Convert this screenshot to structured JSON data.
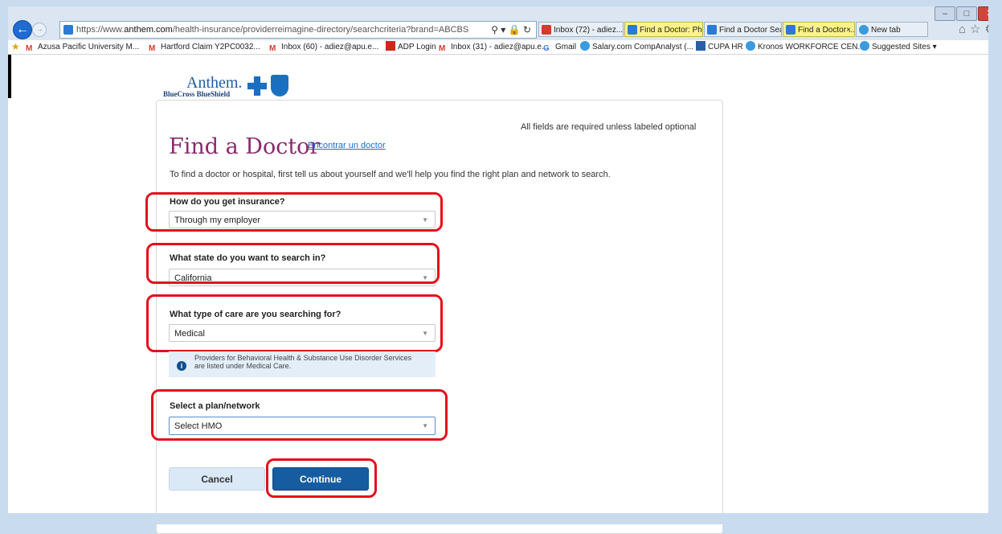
{
  "browser": {
    "url_prefix": "https://www.",
    "url_host": "anthem.com",
    "url_path": "/health-insurance/providerreimagine-directory/searchcriteria?brand=ABCBS",
    "address_tools": "⚲ ▾ 🔒 ↻",
    "tabs": [
      {
        "label": "Inbox (72) - adiez...",
        "style": "gmail"
      },
      {
        "label": "Find a Doctor: Ph...",
        "style": "yellow"
      },
      {
        "label": "Find a Doctor Sea...",
        "style": "normal"
      },
      {
        "label": "Find a Doctor ...",
        "style": "yellow",
        "close": "×"
      },
      {
        "label": "New tab",
        "style": "normal"
      }
    ],
    "toolbar_icons": "⌂☆⚙",
    "window_buttons": {
      "min": "–",
      "max": "□",
      "close": "✕"
    }
  },
  "favorites": [
    {
      "label": "Azusa Pacific University M...",
      "icon": "gmail-icon"
    },
    {
      "label": "Hartford Claim Y2PC0032...",
      "icon": "gmail-icon"
    },
    {
      "label": "Inbox (60) - adiez@apu.e...",
      "icon": "gmail-icon"
    },
    {
      "label": "ADP Login",
      "icon": "adp-icon"
    },
    {
      "label": "Inbox (31) - adiez@apu.e...",
      "icon": "gmail-icon"
    },
    {
      "label": "Gmail",
      "icon": "google-icon"
    },
    {
      "label": "Salary.com CompAnalyst (...",
      "icon": "ie-icon"
    },
    {
      "label": "CUPA HR",
      "icon": "facebook-icon"
    },
    {
      "label": "Kronos WORKFORCE CEN...",
      "icon": "ie-icon"
    },
    {
      "label": "Suggested Sites ▾",
      "icon": "ie-icon"
    }
  ],
  "logo": {
    "word": "Anthem.",
    "sub": "BlueCross BlueShield"
  },
  "page": {
    "required_note": "All fields are required unless labeled optional",
    "title": "Find a Doctor",
    "alt_language_link": "Encontrar un doctor",
    "intro": "To find a doctor or hospital, first tell us about yourself and we'll help you find the right plan and network to search.",
    "insurance": {
      "label": "How do you get insurance?",
      "value": "Through my employer"
    },
    "state": {
      "label": "What state do you want to search in?",
      "value": "California"
    },
    "care": {
      "label": "What type of care are you searching for?",
      "value": "Medical"
    },
    "info": {
      "line1": "Providers for Behavioral Health & Substance Use Disorder Services",
      "line2": "are listed under Medical Care."
    },
    "plan": {
      "label": "Select a plan/network",
      "value": "Select HMO"
    },
    "cancel": "Cancel",
    "continue": "Continue"
  },
  "colors": {
    "highlight": "#e3101b",
    "title": "#8a2a6c",
    "primary_button": "#165ca0"
  }
}
